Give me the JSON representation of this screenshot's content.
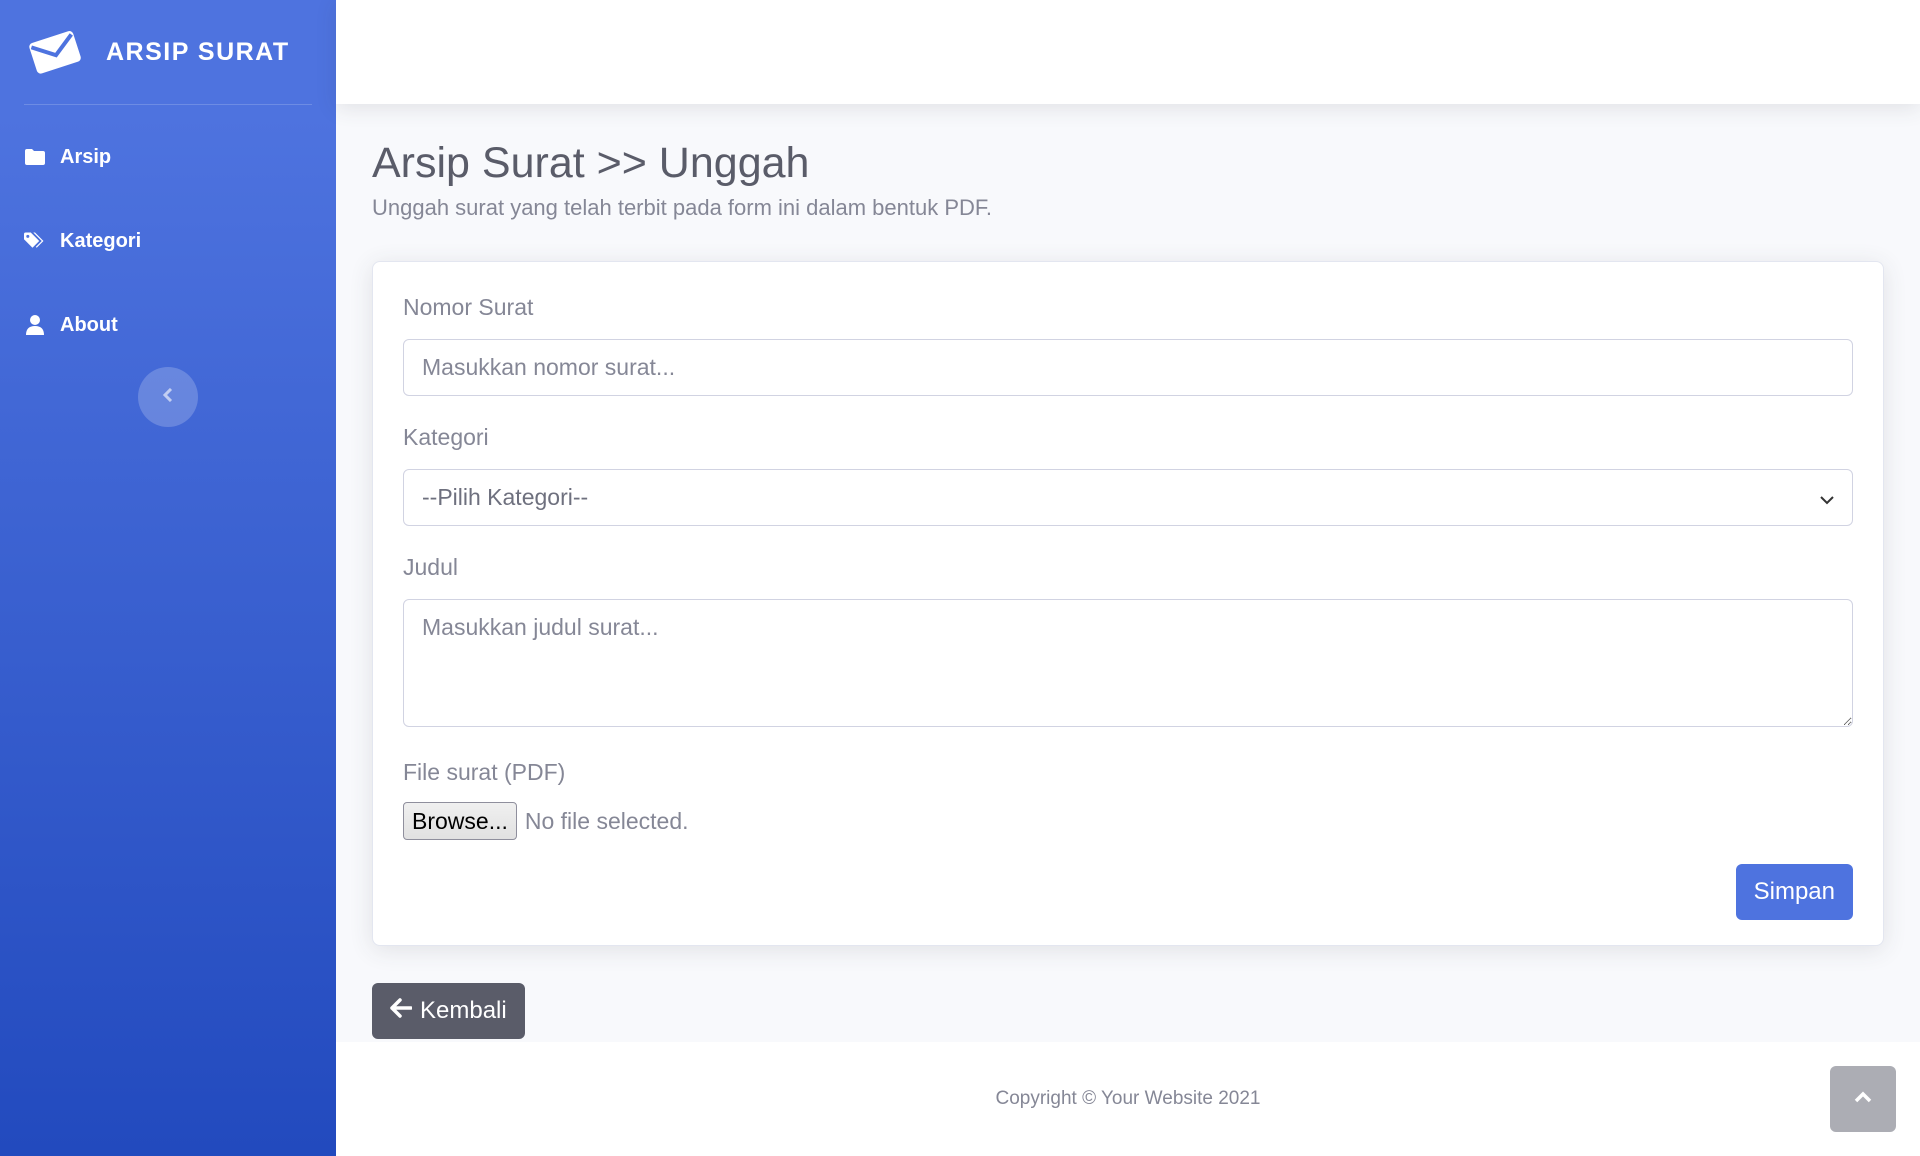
{
  "sidebar": {
    "brand": {
      "icon": "envelope-icon",
      "title": "ARSIP SURAT"
    },
    "items": [
      {
        "icon": "folder-icon",
        "label": "Arsip"
      },
      {
        "icon": "tags-icon",
        "label": "Kategori"
      },
      {
        "icon": "user-icon",
        "label": "About"
      }
    ],
    "toggle_icon": "chevron-left-icon"
  },
  "page": {
    "title": "Arsip Surat >> Unggah",
    "subtitle": "Unggah surat yang telah terbit pada form ini dalam bentuk PDF."
  },
  "form": {
    "nomor": {
      "label": "Nomor Surat",
      "placeholder": "Masukkan nomor surat...",
      "value": ""
    },
    "kategori": {
      "label": "Kategori",
      "selected": "--Pilih Kategori--"
    },
    "judul": {
      "label": "Judul",
      "placeholder": "Masukkan judul surat...",
      "value": ""
    },
    "file": {
      "label": "File surat (PDF)",
      "browse_label": "Browse...",
      "status": "No file selected."
    },
    "submit_label": "Simpan"
  },
  "back_button": {
    "icon": "arrow-left-icon",
    "label": "Kembali"
  },
  "footer": {
    "text": "Copyright © Your Website 2021"
  },
  "scroll_top": {
    "icon": "chevron-up-icon"
  },
  "colors": {
    "primary": "#4e73df",
    "sidebar_gradient_end": "#224abe",
    "secondary": "#5a5c69",
    "text_muted": "#858796",
    "background": "#f8f9fc"
  }
}
